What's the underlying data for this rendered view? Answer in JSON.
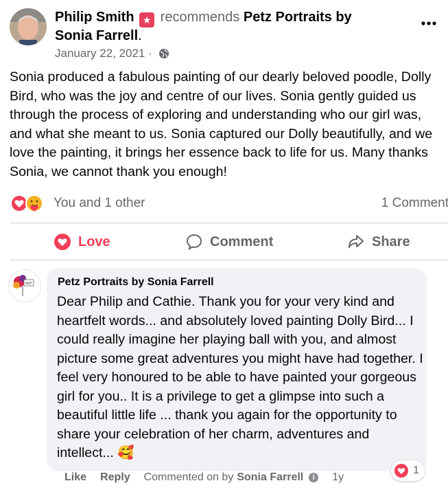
{
  "post": {
    "author": "Philip Smith",
    "verb": "recommends",
    "page_name": "Petz Portraits by Sonia Farrell",
    "suffix": ".",
    "date": "January 22, 2021",
    "date_sep": "·",
    "body": "Sonia produced a fabulous painting of our dearly beloved poodle, Dolly Bird, who was the joy and centre of our lives.  Sonia gently guided us through the process of exploring and understanding who our girl was, and what she meant to us.  Sonia captured our Dolly beautifully, and we love the painting, it brings her essence back to life for us.  Many thanks Sonia, we cannot thank you enough!"
  },
  "reactions": {
    "summary": "You and 1 other",
    "comments_count": "1 Comment",
    "icons": [
      "love-reaction-icon",
      "care-reaction-icon"
    ]
  },
  "actions": {
    "love": "Love",
    "comment": "Comment",
    "share": "Share"
  },
  "comment": {
    "author": "Petz Portraits by Sonia Farrell",
    "text": "Dear Philip and Cathie. Thank you for your very kind and heartfelt words... and absolutely loved painting Dolly Bird... I could really imagine her playing ball with you, and almost picture some great adventures you might have had together. I feel very honoured to be able to have painted your gorgeous girl for you.. It is a privilege to get a glimpse into such a beautiful little life ... thank you again for the opportunity to share your celebration of her charm, adventures and intellect...",
    "emoji": "🥰",
    "reaction_count": "1",
    "like": "Like",
    "reply": "Reply",
    "commented_on_by": "Commented on by",
    "commented_by_name": "Sonia Farrell",
    "age": "1y"
  },
  "colors": {
    "love_red": "#f33e58",
    "secondary_text": "#65676b",
    "bubble_bg": "#f0f2f5",
    "recommend_badge": "#e4405f"
  }
}
